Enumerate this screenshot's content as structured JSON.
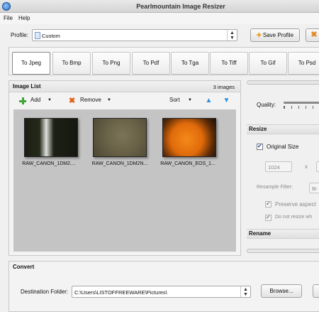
{
  "window": {
    "title": "Pearlmountain Image Resizer"
  },
  "menu": {
    "items": [
      "File",
      "Help"
    ]
  },
  "profile": {
    "label": "Profile:",
    "value": "Custom",
    "save_label": "Save Profile"
  },
  "formats": {
    "tabs": [
      "To Jpeg",
      "To Bmp",
      "To Png",
      "To Pdf",
      "To Tga",
      "To Tiff",
      "To Gif",
      "To Psd"
    ],
    "active_index": 0
  },
  "image_list": {
    "title": "Image List",
    "count": "3 images",
    "add_label": "Add",
    "remove_label": "Remove",
    "sort_label": "Sort",
    "items": [
      {
        "name": "RAW_CANON_1DM2....",
        "thumb": "dark-bark"
      },
      {
        "name": "RAW_CANON_1DM2N...",
        "thumb": "olive-stone"
      },
      {
        "name": "RAW_CANON_EOS_1...",
        "thumb": "orange-fruit"
      }
    ]
  },
  "settings": {
    "quality_label": "Quality:",
    "resize_title": "Resize",
    "original_size_label": "Original Size",
    "width_value": "1024",
    "times_sign": "x",
    "resample_label": "Resample Filter:",
    "resample_value": "Bi",
    "preserve_label": "Preserve aspect",
    "donot_label": "Do not resize wh",
    "rename_title": "Rename"
  },
  "convert": {
    "title": "Convert",
    "dest_label": "Destination Folder:",
    "dest_value": "C:\\Users\\LISTOFFREEWARE\\Pictures\\",
    "browse_label": "Browse..."
  },
  "colors": {
    "accent_blue": "#2e8fe0",
    "add_green": "#3fa535",
    "remove_orange": "#e06010"
  }
}
